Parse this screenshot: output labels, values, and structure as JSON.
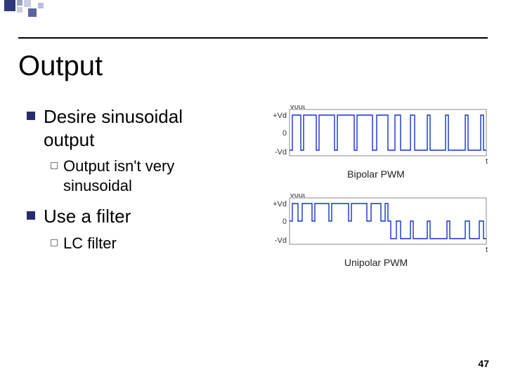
{
  "title": "Output",
  "bullets": [
    {
      "text": "Desire sinusoidal output",
      "sub": [
        {
          "text": "Output isn't very sinusoidal"
        }
      ]
    },
    {
      "text": "Use a filter",
      "sub": [
        {
          "text": "LC filter"
        }
      ]
    }
  ],
  "figures": {
    "bipolar": {
      "caption": "Bipolar PWM",
      "ylabel": "Vout",
      "yticks": [
        "+Vd",
        "0",
        "-Vd"
      ]
    },
    "unipolar": {
      "caption": "Unipolar PWM",
      "ylabel": "Vout",
      "yticks": [
        "+Vd",
        "0",
        "-Vd"
      ]
    }
  },
  "page_number": "47",
  "chart_data": [
    {
      "type": "line",
      "title": "Bipolar PWM",
      "ylabel": "Vout",
      "yticks": [
        "+Vd",
        "0",
        "-Vd"
      ],
      "ylim": [
        -1,
        1
      ],
      "description": "Square wave switching between +Vd and -Vd with duty cycle following a sinusoidal reference (SPWM). Pulse widths widen near sine peaks, narrow near zero crossings.",
      "pulses_per_half_cycle": 11,
      "levels": [
        1,
        -1
      ]
    },
    {
      "type": "line",
      "title": "Unipolar PWM",
      "ylabel": "Vout",
      "yticks": [
        "+Vd",
        "0",
        "-Vd"
      ],
      "ylim": [
        -1,
        1
      ],
      "description": "Three-level output: switches between +Vd and 0 during positive half-cycle, and between 0 and -Vd during negative half-cycle. Pulse widths track |sin|.",
      "pulses_per_half_cycle": 11,
      "levels": [
        1,
        0,
        -1
      ]
    }
  ]
}
